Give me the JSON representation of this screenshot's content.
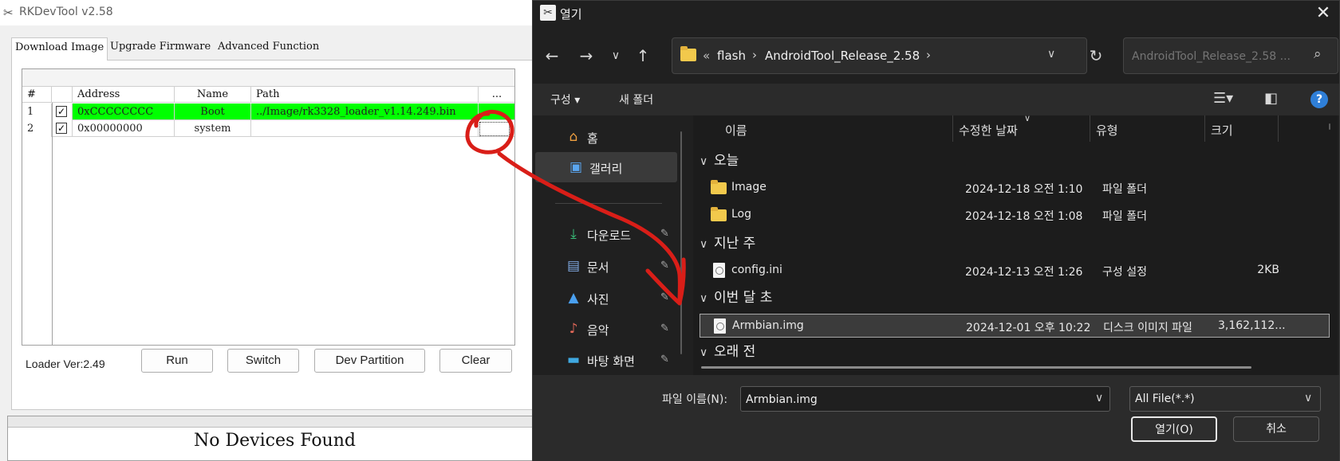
{
  "rkdevtool": {
    "title": "RKDevTool v2.58",
    "tabs": [
      "Download Image",
      "Upgrade Firmware",
      "Advanced Function"
    ],
    "grid": {
      "headers": [
        "#",
        "",
        "Address",
        "Name",
        "Path",
        "..."
      ],
      "rows": [
        {
          "index": "1",
          "checked": true,
          "address": "0xCCCCCCCC",
          "name": "Boot",
          "path": "../Image/rk3328_loader_v1.14.249.bin",
          "highlight_color": "#00ff00"
        },
        {
          "index": "2",
          "checked": true,
          "address": "0x00000000",
          "name": "system",
          "path": "",
          "highlight_color": ""
        }
      ]
    },
    "loader_version": "Loader Ver:2.49",
    "buttons": {
      "run": "Run",
      "switch": "Switch",
      "dev_partition": "Dev Partition",
      "clear": "Clear"
    },
    "status_message": "No Devices Found"
  },
  "open_dialog": {
    "title": "열기",
    "close_glyph": "✕",
    "breadcrumb": [
      "flash",
      "AndroidTool_Release_2.58"
    ],
    "breadcrumb_prefix": "«",
    "search_placeholder": "AndroidTool_Release_2.58 ...",
    "toolbar": {
      "organize": "구성 ▾",
      "new_folder": "새 폴더"
    },
    "nav_items": [
      {
        "label": "홈",
        "icon": "home-icon",
        "pinned": false
      },
      {
        "label": "갤러리",
        "icon": "gallery-icon",
        "pinned": false
      },
      {
        "label": "다운로드",
        "icon": "download-icon",
        "pinned": true
      },
      {
        "label": "문서",
        "icon": "document-icon",
        "pinned": true
      },
      {
        "label": "사진",
        "icon": "pictures-icon",
        "pinned": true
      },
      {
        "label": "음악",
        "icon": "music-icon",
        "pinned": true
      },
      {
        "label": "바탕 화면",
        "icon": "desktop-icon",
        "pinned": true
      }
    ],
    "columns": {
      "name": "이름",
      "modified": "수정한 날짜",
      "type": "유형",
      "size": "크기"
    },
    "groups": [
      {
        "label": "오늘",
        "files": [
          {
            "name": "Image",
            "modified": "2024-12-18 오전 1:10",
            "type": "파일 폴더",
            "size": "",
            "kind": "folder"
          },
          {
            "name": "Log",
            "modified": "2024-12-18 오전 1:08",
            "type": "파일 폴더",
            "size": "",
            "kind": "folder"
          }
        ]
      },
      {
        "label": "지난 주",
        "files": [
          {
            "name": "config.ini",
            "modified": "2024-12-13 오전 1:26",
            "type": "구성 설정",
            "size": "2KB",
            "kind": "file"
          }
        ]
      },
      {
        "label": "이번 달 초",
        "files": [
          {
            "name": "Armbian.img",
            "modified": "2024-12-01 오후 10:22",
            "type": "디스크 이미지 파일",
            "size": "3,162,112...",
            "kind": "file",
            "selected": true
          }
        ]
      },
      {
        "label": "오래 전",
        "files": []
      }
    ],
    "filename_label": "파일 이름(N):",
    "filename_value": "Armbian.img",
    "filetype_value": "All File(*.*)",
    "open_button": "열기(O)",
    "cancel_button": "취소"
  },
  "annotation_color": "#d91e18"
}
